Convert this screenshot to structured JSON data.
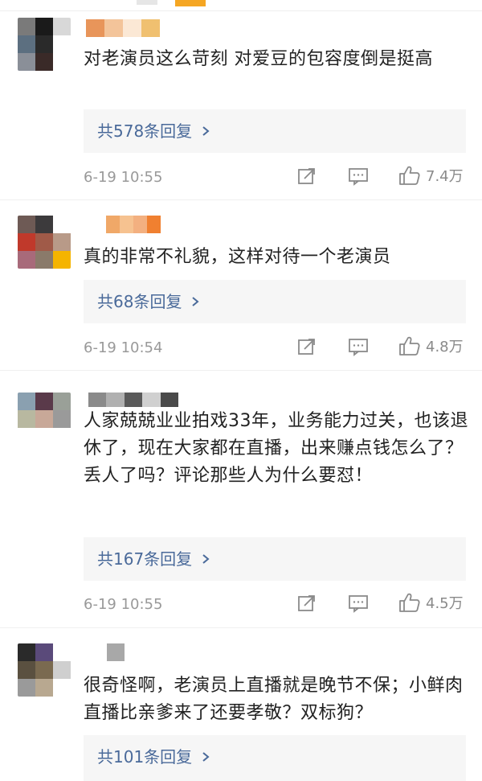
{
  "comments": [
    {
      "text": "对老演员这么苛刻 对爱豆的包容度倒是挺高",
      "reply_label": "共578条回复",
      "time": "6-19 10:55",
      "likes": "7.4万",
      "avatar_colors": [
        "#7a7a7a",
        "#1a1a1a",
        "#d8d8d8",
        "#5c6f80",
        "#2a2a2a",
        "#ffffff",
        "#8a8f98",
        "#3a2a28",
        "#ffffff"
      ],
      "name_colors": [
        "#e8955a",
        "#f3c49a",
        "#fbe8d5",
        "#f0c070"
      ]
    },
    {
      "text": "真的非常不礼貌，这样对待一个老演员",
      "reply_label": "共68条回复",
      "time": "6-19 10:54",
      "likes": "4.8万",
      "avatar_colors": [
        "#6e5a55",
        "#3c3a3c",
        "#ffffff",
        "#c0392b",
        "#a05a48",
        "#b89a88",
        "#a86a7a",
        "#8a7a6a",
        "#f5b400"
      ],
      "name_colors": [
        "#f0a868",
        "#f6c290",
        "#f3b080",
        "#f08030"
      ]
    },
    {
      "text": "人家兢兢业业拍戏33年，业务能力过关，也该退休了，现在大家都在直播，出来赚点钱怎么了？丢人了吗？评论那些人为什么要怼！",
      "reply_label": "共167条回复",
      "time": "6-19 10:55",
      "likes": "4.5万",
      "avatar_colors": [
        "#8aa0b0",
        "#5a3a4a",
        "#9aa098",
        "#b8b8a0",
        "#c8a898",
        "#9a9a9a",
        "#ffffff",
        "#ffffff",
        "#ffffff"
      ],
      "name_colors": [
        "#8a8a8a",
        "#b0b0b0",
        "#5a5a5a",
        "#d0d0d0",
        "#4a4a4a"
      ]
    },
    {
      "text": "很奇怪啊，老演员上直播就是晚节不保；小鲜肉直播比亲爹来了还要孝敬？双标狗？",
      "reply_label": "共101条回复",
      "time": "",
      "likes": "",
      "avatar_colors": [
        "#2a2a2a",
        "#5a4a7a",
        "#ffffff",
        "#5a5040",
        "#7a6a50",
        "#cfcfcf",
        "#9a9a9a",
        "#b8a890",
        "#ffffff"
      ],
      "name_colors": [
        "#a8a8a8"
      ]
    }
  ]
}
